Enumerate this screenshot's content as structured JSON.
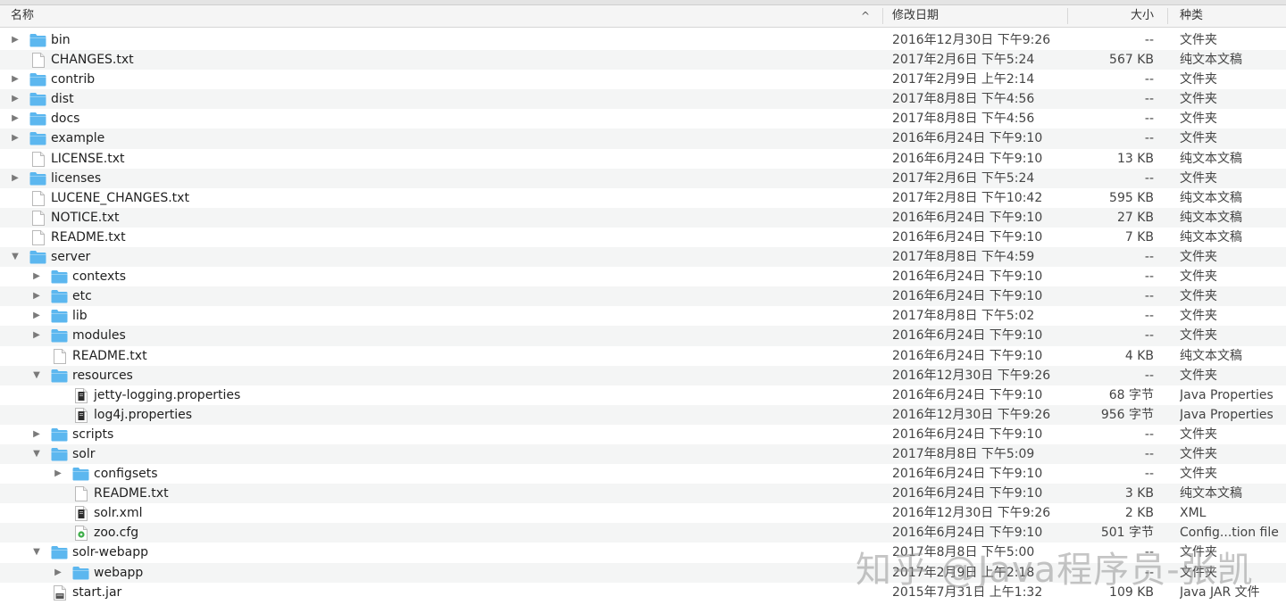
{
  "header": {
    "name": "名称",
    "date": "修改日期",
    "size": "大小",
    "kind": "种类",
    "sort_indicator": "^"
  },
  "colors": {
    "folder": "#5cb7ef",
    "stripe": "#f4f5f5",
    "header_bg": "#f5f5f5"
  },
  "rows": [
    {
      "name": "bin",
      "date": "2016年12月30日 下午9:26",
      "size": "--",
      "kind": "文件夹",
      "level": 0,
      "type": "folder",
      "disclosure": "collapsed"
    },
    {
      "name": "CHANGES.txt",
      "date": "2017年2月6日 下午5:24",
      "size": "567 KB",
      "kind": "纯文本文稿",
      "level": 0,
      "type": "text",
      "disclosure": "none"
    },
    {
      "name": "contrib",
      "date": "2017年2月9日 上午2:14",
      "size": "--",
      "kind": "文件夹",
      "level": 0,
      "type": "folder",
      "disclosure": "collapsed"
    },
    {
      "name": "dist",
      "date": "2017年8月8日 下午4:56",
      "size": "--",
      "kind": "文件夹",
      "level": 0,
      "type": "folder",
      "disclosure": "collapsed"
    },
    {
      "name": "docs",
      "date": "2017年8月8日 下午4:56",
      "size": "--",
      "kind": "文件夹",
      "level": 0,
      "type": "folder",
      "disclosure": "collapsed"
    },
    {
      "name": "example",
      "date": "2016年6月24日 下午9:10",
      "size": "--",
      "kind": "文件夹",
      "level": 0,
      "type": "folder",
      "disclosure": "collapsed"
    },
    {
      "name": "LICENSE.txt",
      "date": "2016年6月24日 下午9:10",
      "size": "13 KB",
      "kind": "纯文本文稿",
      "level": 0,
      "type": "text",
      "disclosure": "none"
    },
    {
      "name": "licenses",
      "date": "2017年2月6日 下午5:24",
      "size": "--",
      "kind": "文件夹",
      "level": 0,
      "type": "folder",
      "disclosure": "collapsed"
    },
    {
      "name": "LUCENE_CHANGES.txt",
      "date": "2017年2月8日 下午10:42",
      "size": "595 KB",
      "kind": "纯文本文稿",
      "level": 0,
      "type": "text",
      "disclosure": "none"
    },
    {
      "name": "NOTICE.txt",
      "date": "2016年6月24日 下午9:10",
      "size": "27 KB",
      "kind": "纯文本文稿",
      "level": 0,
      "type": "text",
      "disclosure": "none"
    },
    {
      "name": "README.txt",
      "date": "2016年6月24日 下午9:10",
      "size": "7 KB",
      "kind": "纯文本文稿",
      "level": 0,
      "type": "text",
      "disclosure": "none"
    },
    {
      "name": "server",
      "date": "2017年8月8日 下午4:59",
      "size": "--",
      "kind": "文件夹",
      "level": 0,
      "type": "folder",
      "disclosure": "expanded"
    },
    {
      "name": "contexts",
      "date": "2016年6月24日 下午9:10",
      "size": "--",
      "kind": "文件夹",
      "level": 1,
      "type": "folder",
      "disclosure": "collapsed"
    },
    {
      "name": "etc",
      "date": "2016年6月24日 下午9:10",
      "size": "--",
      "kind": "文件夹",
      "level": 1,
      "type": "folder",
      "disclosure": "collapsed"
    },
    {
      "name": "lib",
      "date": "2017年8月8日 下午5:02",
      "size": "--",
      "kind": "文件夹",
      "level": 1,
      "type": "folder",
      "disclosure": "collapsed"
    },
    {
      "name": "modules",
      "date": "2016年6月24日 下午9:10",
      "size": "--",
      "kind": "文件夹",
      "level": 1,
      "type": "folder",
      "disclosure": "collapsed"
    },
    {
      "name": "README.txt",
      "date": "2016年6月24日 下午9:10",
      "size": "4 KB",
      "kind": "纯文本文稿",
      "level": 1,
      "type": "text",
      "disclosure": "none"
    },
    {
      "name": "resources",
      "date": "2016年12月30日 下午9:26",
      "size": "--",
      "kind": "文件夹",
      "level": 1,
      "type": "folder",
      "disclosure": "expanded"
    },
    {
      "name": "jetty-logging.properties",
      "date": "2016年6月24日 下午9:10",
      "size": "68 字节",
      "kind": "Java Properties",
      "level": 2,
      "type": "dark",
      "disclosure": "none"
    },
    {
      "name": "log4j.properties",
      "date": "2016年12月30日 下午9:26",
      "size": "956 字节",
      "kind": "Java Properties",
      "level": 2,
      "type": "dark",
      "disclosure": "none"
    },
    {
      "name": "scripts",
      "date": "2016年6月24日 下午9:10",
      "size": "--",
      "kind": "文件夹",
      "level": 1,
      "type": "folder",
      "disclosure": "collapsed"
    },
    {
      "name": "solr",
      "date": "2017年8月8日 下午5:09",
      "size": "--",
      "kind": "文件夹",
      "level": 1,
      "type": "folder",
      "disclosure": "expanded"
    },
    {
      "name": "configsets",
      "date": "2016年6月24日 下午9:10",
      "size": "--",
      "kind": "文件夹",
      "level": 2,
      "type": "folder",
      "disclosure": "collapsed"
    },
    {
      "name": "README.txt",
      "date": "2016年6月24日 下午9:10",
      "size": "3 KB",
      "kind": "纯文本文稿",
      "level": 2,
      "type": "text",
      "disclosure": "none"
    },
    {
      "name": "solr.xml",
      "date": "2016年12月30日 下午9:26",
      "size": "2 KB",
      "kind": "XML",
      "level": 2,
      "type": "dark",
      "disclosure": "none"
    },
    {
      "name": "zoo.cfg",
      "date": "2016年6月24日 下午9:10",
      "size": "501 字节",
      "kind": "Config...tion file",
      "level": 2,
      "type": "cfg",
      "disclosure": "none"
    },
    {
      "name": "solr-webapp",
      "date": "2017年8月8日 下午5:00",
      "size": "--",
      "kind": "文件夹",
      "level": 1,
      "type": "folder",
      "disclosure": "expanded"
    },
    {
      "name": "webapp",
      "date": "2017年2月9日 上午2:18",
      "size": "--",
      "kind": "文件夹",
      "level": 2,
      "type": "folder",
      "disclosure": "collapsed"
    },
    {
      "name": "start.jar",
      "date": "2015年7月31日 上午1:32",
      "size": "109 KB",
      "kind": "Java JAR 文件",
      "level": 1,
      "type": "jar",
      "disclosure": "none"
    }
  ],
  "watermark": "知乎 @Java程序员-张凯"
}
